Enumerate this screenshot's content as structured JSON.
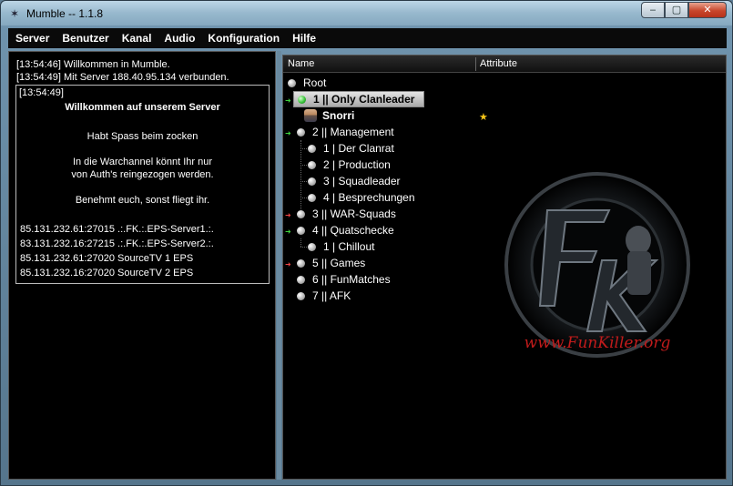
{
  "window": {
    "title": "Mumble -- 1.1.8"
  },
  "menu": [
    "Server",
    "Benutzer",
    "Kanal",
    "Audio",
    "Konfiguration",
    "Hilfe"
  ],
  "log": {
    "lines": [
      "[13:54:46] Willkommen in Mumble.",
      "[13:54:49] Mit Server 188.40.95.134 verbunden."
    ],
    "message": {
      "time": "[13:54:49]",
      "heading": "Willkommen auf unserem Server",
      "line1": "Habt Spass beim zocken",
      "line2": "In die Warchannel könnt Ihr nur",
      "line3": "von Auth's reingezogen werden.",
      "line4": "Benehmt euch, sonst fliegt ihr.",
      "servers": [
        "85.131.232.61:27015 .:.FK.:.EPS-Server1.:.",
        "83.131.232.16:27215 .:.FK.:.EPS-Server2.:.",
        "85.131.232.61:27020 SourceTV 1 EPS",
        "85.131.232.16:27020 SourceTV 2 EPS"
      ]
    }
  },
  "tree": {
    "col_name": "Name",
    "col_attr": "Attribute",
    "root": "Root",
    "channels": [
      {
        "label": "1 || Only Clanleader"
      },
      {
        "label": "Snorri"
      },
      {
        "label": "2 || Management"
      },
      {
        "label": "1 | Der Clanrat"
      },
      {
        "label": "2 | Production"
      },
      {
        "label": "3 | Squadleader"
      },
      {
        "label": "4 | Besprechungen"
      },
      {
        "label": "3 || WAR-Squads"
      },
      {
        "label": "4 || Quatschecke"
      },
      {
        "label": "1 | Chillout"
      },
      {
        "label": "5 || Games"
      },
      {
        "label": "6 || FunMatches"
      },
      {
        "label": "7 || AFK"
      }
    ],
    "logo_text": "www.FunKiller.org",
    "logo_letters": "FK"
  },
  "colors": {
    "accent_green": "#3bc43b",
    "star": "#f5c518",
    "background": "#000000"
  }
}
